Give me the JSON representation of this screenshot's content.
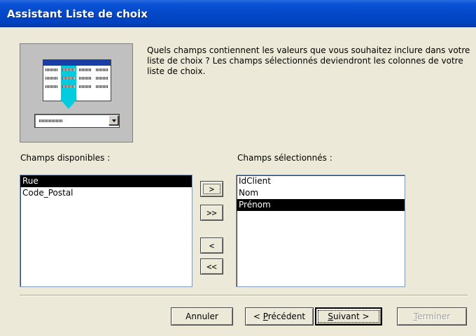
{
  "window": {
    "title": "Assistant Liste de choix"
  },
  "instructions": "Quels champs contiennent les valeurs que vous souhaitez inclure dans votre liste de choix ? Les champs sélectionnés deviendront les colonnes de votre liste de choix.",
  "available": {
    "label": "Champs disponibles :",
    "items": [
      "Rue",
      "Code_Postal"
    ],
    "selected_index": 0
  },
  "selected": {
    "label": "Champs sélectionnés :",
    "items": [
      "IdClient",
      "Nom",
      "Prénom"
    ],
    "selected_index": 2
  },
  "move_buttons": {
    "add_one": ">",
    "add_all": ">>",
    "remove_one": "<",
    "remove_all": "<<"
  },
  "footer": {
    "cancel": "Annuler",
    "back_prefix": "< ",
    "back_mnemonic": "P",
    "back_rest": "récédent",
    "next_mnemonic": "S",
    "next_rest": "uivant >",
    "finish_mnemonic": "T",
    "finish_rest": "erminer"
  },
  "colors": {
    "title_bar": "#0348c8",
    "dialog_bg": "#ece9d8",
    "selection": "#000000",
    "illustration_accent": "#00ccdd"
  }
}
